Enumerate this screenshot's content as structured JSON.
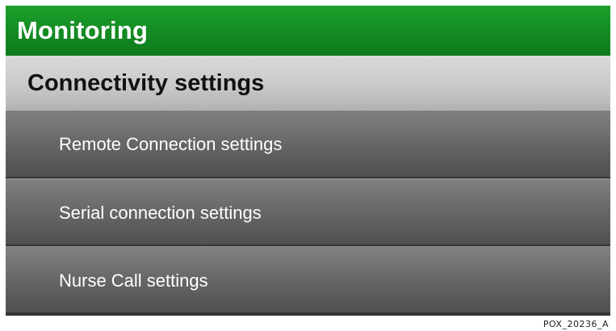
{
  "header": {
    "title": "Monitoring"
  },
  "section": {
    "title": "Connectivity settings"
  },
  "menu": {
    "items": [
      {
        "label": "Remote Connection settings"
      },
      {
        "label": "Serial connection settings"
      },
      {
        "label": "Nurse Call settings"
      }
    ]
  },
  "footer": {
    "code": "POX_20236_A"
  },
  "colors": {
    "header_bar": "#138b22",
    "section_bar": "#c8c9ca",
    "menu_item": "#67696b"
  }
}
